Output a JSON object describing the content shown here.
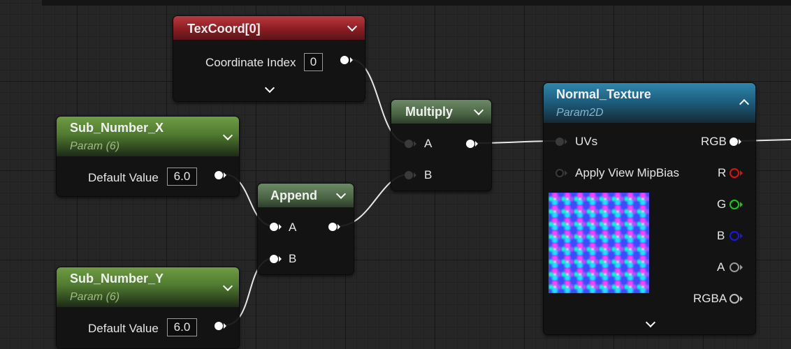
{
  "nodes": {
    "texcoord": {
      "title": "TexCoord[0]",
      "row_label": "Coordinate Index",
      "value": "0",
      "header_color": "#a8242a"
    },
    "sub_number_x": {
      "title": "Sub_Number_X",
      "subtitle": "Param (6)",
      "row_label": "Default Value",
      "value": "6.0",
      "header_color": "#5e8a35"
    },
    "sub_number_y": {
      "title": "Sub_Number_Y",
      "subtitle": "Param (6)",
      "row_label": "Default Value",
      "value": "6.0",
      "header_color": "#5e8a35"
    },
    "append": {
      "title": "Append",
      "pin_a": "A",
      "pin_b": "B",
      "header_color": "#55774e"
    },
    "multiply": {
      "title": "Multiply",
      "pin_a": "A",
      "pin_b": "B",
      "header_color": "#55774e"
    },
    "normal_texture": {
      "title": "Normal_Texture",
      "subtitle": "Param2D",
      "header_color": "#1f6f93",
      "inputs": [
        "UVs",
        "Apply View MipBias"
      ],
      "outputs": [
        "RGB",
        "R",
        "G",
        "B",
        "A",
        "RGBA"
      ],
      "output_colors": {
        "R": "#e01010",
        "G": "#10d010",
        "B": "#1818e8",
        "A": "#9a9a9a",
        "RGBA": "#bdbdbd"
      }
    }
  }
}
